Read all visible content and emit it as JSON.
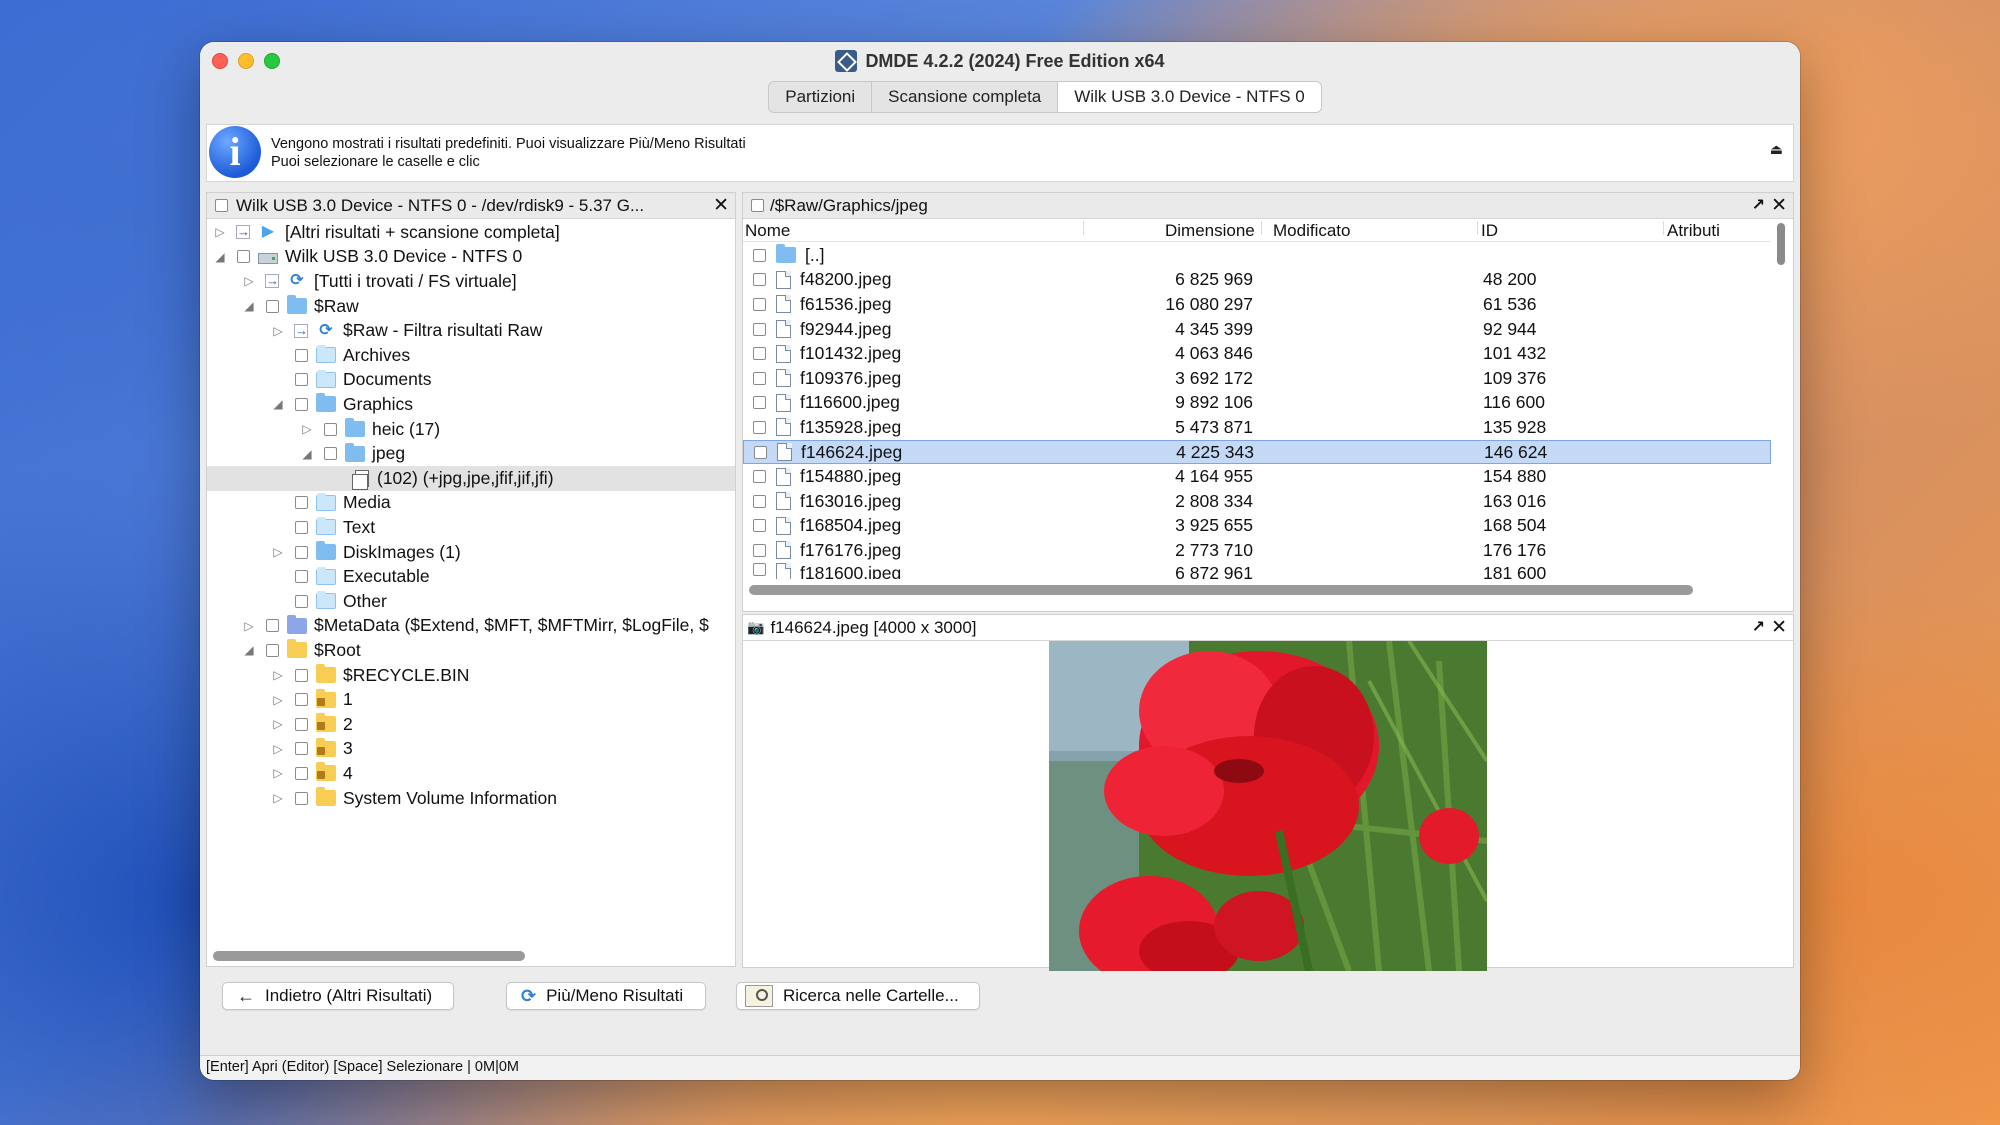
{
  "window": {
    "title": "DMDE 4.2.2 (2024) Free Edition x64",
    "tabs": [
      "Partizioni",
      "Scansione completa",
      "Wilk USB 3.0 Device - NTFS 0"
    ],
    "active_tab": "Wilk USB 3.0 Device - NTFS 0"
  },
  "info": {
    "line1": "Vengono mostrati i risultati predefiniti. Puoi visualizzare Più/Meno Risultati",
    "line2": "Puoi selezionare le caselle e clic",
    "icon": "info-icon"
  },
  "left_panel": {
    "title": "Wilk USB 3.0 Device - NTFS 0 - /dev/rdisk9 - 5.37 G...",
    "tree": [
      {
        "label": "[Altri risultati + scansione completa]",
        "icon": "play-icon",
        "indent": 0,
        "twisty": "▷",
        "checkbox": false,
        "extra": "arrow"
      },
      {
        "label": "Wilk USB 3.0 Device - NTFS 0",
        "icon": "drive-icon",
        "indent": 0,
        "twisty": "◢",
        "checkbox": true
      },
      {
        "label": "[Tutti i trovati / FS virtuale]",
        "icon": "refresh-icon",
        "indent": 1,
        "twisty": "▷",
        "checkbox": false,
        "extra": "arrow"
      },
      {
        "label": "$Raw",
        "icon": "folder-icon",
        "indent": 1,
        "twisty": "◢",
        "checkbox": true
      },
      {
        "label": "$Raw - Filtra risultati Raw",
        "icon": "refresh-icon",
        "indent": 2,
        "twisty": "▷",
        "checkbox": false,
        "extra": "arrow"
      },
      {
        "label": "Archives",
        "icon": "folder-light-icon",
        "indent": 2,
        "twisty": "",
        "checkbox": true
      },
      {
        "label": "Documents",
        "icon": "folder-light-icon",
        "indent": 2,
        "twisty": "",
        "checkbox": true
      },
      {
        "label": "Graphics",
        "icon": "folder-icon",
        "indent": 2,
        "twisty": "◢",
        "checkbox": true
      },
      {
        "label": "heic (17)",
        "icon": "folder-icon",
        "indent": 3,
        "twisty": "▷",
        "checkbox": true
      },
      {
        "label": "jpeg",
        "icon": "folder-icon",
        "indent": 3,
        "twisty": "◢",
        "checkbox": true
      },
      {
        "label": "(102) (+jpg,jpe,jfif,jif,jfi)",
        "icon": "file-stack-icon",
        "indent": 4,
        "twisty": "",
        "checkbox": false,
        "selected": true
      },
      {
        "label": "Media",
        "icon": "folder-light-icon",
        "indent": 2,
        "twisty": "",
        "checkbox": true
      },
      {
        "label": "Text",
        "icon": "folder-light-icon",
        "indent": 2,
        "twisty": "",
        "checkbox": true
      },
      {
        "label": "DiskImages (1)",
        "icon": "folder-icon",
        "indent": 2,
        "twisty": "▷",
        "checkbox": true
      },
      {
        "label": "Executable",
        "icon": "folder-light-icon",
        "indent": 2,
        "twisty": "",
        "checkbox": true
      },
      {
        "label": "Other",
        "icon": "folder-light-icon",
        "indent": 2,
        "twisty": "",
        "checkbox": true
      },
      {
        "label": "$MetaData ($Extend, $MFT, $MFTMirr, $LogFile, $",
        "icon": "folder-purple-icon",
        "indent": 1,
        "twisty": "▷",
        "checkbox": true
      },
      {
        "label": "$Root",
        "icon": "folder-yellow-icon",
        "indent": 1,
        "twisty": "◢",
        "checkbox": true
      },
      {
        "label": "$RECYCLE.BIN",
        "icon": "folder-yellow-icon",
        "indent": 2,
        "twisty": "▷",
        "checkbox": true
      },
      {
        "label": "1",
        "icon": "folder-lock-icon",
        "indent": 2,
        "twisty": "▷",
        "checkbox": true
      },
      {
        "label": "2",
        "icon": "folder-lock-icon",
        "indent": 2,
        "twisty": "▷",
        "checkbox": true
      },
      {
        "label": "3",
        "icon": "folder-lock-icon",
        "indent": 2,
        "twisty": "▷",
        "checkbox": true
      },
      {
        "label": "4",
        "icon": "folder-lock-icon",
        "indent": 2,
        "twisty": "▷",
        "checkbox": true
      },
      {
        "label": "System Volume Information",
        "icon": "folder-yellow-icon",
        "indent": 2,
        "twisty": "▷",
        "checkbox": true
      }
    ]
  },
  "file_panel": {
    "path": "/$Raw/Graphics/jpeg",
    "columns": {
      "name": "Nome",
      "size": "Dimensione",
      "modified": "Modificato",
      "id": "ID",
      "attrs": "Atributi"
    },
    "parent_label": "[..]",
    "files": [
      {
        "name": "f48200.jpeg",
        "size": "6 825 969",
        "id": "48 200"
      },
      {
        "name": "f61536.jpeg",
        "size": "16 080 297",
        "id": "61 536"
      },
      {
        "name": "f92944.jpeg",
        "size": "4 345 399",
        "id": "92 944"
      },
      {
        "name": "f101432.jpeg",
        "size": "4 063 846",
        "id": "101 432"
      },
      {
        "name": "f109376.jpeg",
        "size": "3 692 172",
        "id": "109 376"
      },
      {
        "name": "f116600.jpeg",
        "size": "9 892 106",
        "id": "116 600"
      },
      {
        "name": "f135928.jpeg",
        "size": "5 473 871",
        "id": "135 928"
      },
      {
        "name": "f146624.jpeg",
        "size": "4 225 343",
        "id": "146 624",
        "selected": true
      },
      {
        "name": "f154880.jpeg",
        "size": "4 164 955",
        "id": "154 880"
      },
      {
        "name": "f163016.jpeg",
        "size": "2 808 334",
        "id": "163 016"
      },
      {
        "name": "f168504.jpeg",
        "size": "3 925 655",
        "id": "168 504"
      },
      {
        "name": "f176176.jpeg",
        "size": "2 773 710",
        "id": "176 176"
      },
      {
        "name": "f181600.jpeg",
        "size": "6 872 961",
        "id": "181 600"
      }
    ]
  },
  "preview_panel": {
    "title": "f146624.jpeg [4000 x 3000]"
  },
  "buttons": {
    "back": "Indietro (Altri Risultati)",
    "more_less": "Più/Meno Risultati",
    "search": "Ricerca nelle Cartelle..."
  },
  "status": "[Enter] Apri (Editor)  [Space] Selezionare | 0M|0M",
  "colors": {
    "selection": "#c4d9f6",
    "folder": "#7fbdf0",
    "accent": "#2a80d8"
  }
}
